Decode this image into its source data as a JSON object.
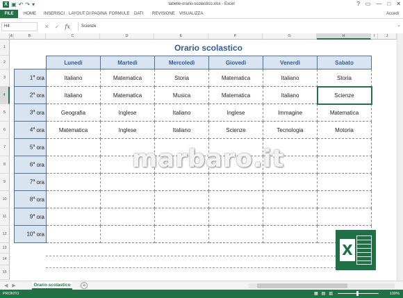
{
  "window": {
    "title": "tabelle-orario-scolastico.xlsx - Excel",
    "controls": [
      "?",
      "▭",
      "—",
      "□",
      "✕"
    ]
  },
  "quick_access": [
    "save-icon",
    "undo-icon",
    "redo-icon"
  ],
  "ribbon": {
    "tabs": [
      "FILE",
      "HOME",
      "INSERISCI",
      "LAYOUT DI PAGINA",
      "FORMULE",
      "DATI",
      "REVISIONE",
      "VISUALIZZA"
    ],
    "account": "Accedi"
  },
  "formula_bar": {
    "name_box": "H4",
    "fx": "fx",
    "value": "Scienze"
  },
  "columns": [
    "A",
    "B",
    "C",
    "D",
    "E",
    "F",
    "G",
    "H",
    "I",
    "J"
  ],
  "rows": [
    "1",
    "2",
    "3",
    "4",
    "5",
    "6",
    "7",
    "8",
    "9",
    "10",
    "11",
    "12",
    "13",
    "14",
    "15"
  ],
  "selected_cell": {
    "column": "H",
    "row": "4"
  },
  "sheet": {
    "title": "Orario scolastico",
    "days": [
      "Lunedì",
      "Martedì",
      "Mercoledì",
      "Giovedì",
      "Venerdì",
      "Sabato"
    ],
    "periods": [
      {
        "num": "1",
        "sup": "a",
        "label": "ora",
        "subjects": [
          "Italiano",
          "Matematica",
          "Storia",
          "Matematica",
          "Italiano",
          "Storia"
        ]
      },
      {
        "num": "2",
        "sup": "a",
        "label": "ora",
        "subjects": [
          "Italiano",
          "Matematica",
          "Musica",
          "Matematica",
          "Italiano",
          "Scienze"
        ]
      },
      {
        "num": "3",
        "sup": "a",
        "label": "ora",
        "subjects": [
          "Geografia",
          "Inglese",
          "Italiano",
          "Inglese",
          "Immagine",
          "Matematica"
        ]
      },
      {
        "num": "4",
        "sup": "a",
        "label": "ora",
        "subjects": [
          "Matematica",
          "Inglese",
          "Italiano",
          "Scienze",
          "Tecnologia",
          "Motoria"
        ]
      },
      {
        "num": "5",
        "sup": "a",
        "label": "ora",
        "subjects": [
          "",
          "",
          "",
          "",
          "",
          ""
        ]
      },
      {
        "num": "6",
        "sup": "a",
        "label": "ora",
        "subjects": [
          "",
          "",
          "",
          "",
          "",
          ""
        ]
      },
      {
        "num": "7",
        "sup": "a",
        "label": "ora",
        "subjects": [
          "",
          "",
          "",
          "",
          "",
          ""
        ]
      },
      {
        "num": "8",
        "sup": "a",
        "label": "ora",
        "subjects": [
          "",
          "",
          "",
          "",
          "",
          ""
        ]
      },
      {
        "num": "9",
        "sup": "a",
        "label": "ora",
        "subjects": [
          "",
          "",
          "",
          "",
          "",
          ""
        ]
      },
      {
        "num": "10",
        "sup": "a",
        "label": "ora",
        "subjects": [
          "",
          "",
          "",
          "",
          "",
          ""
        ]
      }
    ]
  },
  "watermark": "marbaro.it",
  "sheet_tab": {
    "name": "Orario scolastico",
    "add": "+"
  },
  "status": {
    "ready": "PRONTO",
    "zoom": "100%"
  },
  "colors": {
    "excel_green": "#217346",
    "header_fill": "#d9e4f1",
    "title_blue": "#2e5b9a"
  }
}
